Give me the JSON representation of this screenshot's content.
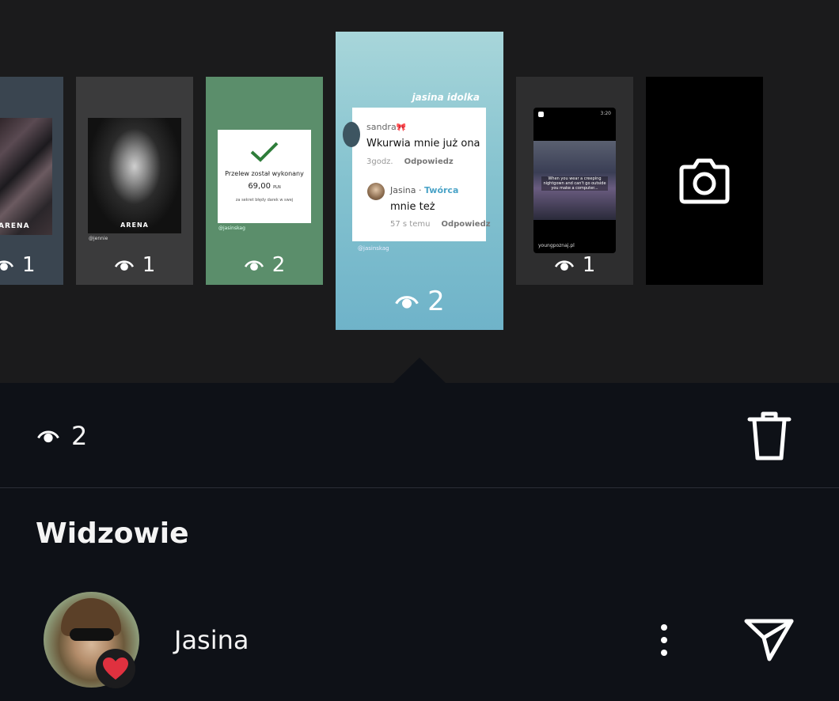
{
  "stories": [
    {
      "id": "t1",
      "image_label": "ARENA",
      "views": "1"
    },
    {
      "id": "t2",
      "image_label": "ARENA",
      "handle": "@jennie",
      "views": "1"
    },
    {
      "id": "t3",
      "transfer_title": "Przelew został wykonany",
      "amount": "69,00",
      "currency": "PLN",
      "note": "za sekret błędy darek w swej",
      "handle": "@jasinskag",
      "views": "2"
    },
    {
      "id": "t4",
      "selected": true,
      "tag": "jasina idolka",
      "handle": "@jasinskag",
      "views": "2",
      "comment": {
        "user": "sandra",
        "bow": "🎀",
        "text": "Wkurwia mnie już ona",
        "time": "3godz.",
        "reply_label": "Odpowiedz"
      },
      "reply": {
        "user": "Jasina",
        "separator": " · ",
        "role": "Twórca",
        "text": "mnie też",
        "time": "57 s temu",
        "reply_label": "Odpowiedz"
      }
    },
    {
      "id": "t5",
      "time": "3:20",
      "caption": "When you wear a creeping nightgown and can't go outside you make a computer...",
      "site": "youngpoznaj.pl",
      "views": "1"
    },
    {
      "id": "t6",
      "icon": "camera-icon"
    }
  ],
  "summary": {
    "views": "2",
    "delete_icon": "trash-icon"
  },
  "section_title": "Widzowie",
  "viewers": [
    {
      "name": "Jasina",
      "reaction": "heart",
      "actions": [
        "more-options-icon",
        "send-icon"
      ]
    }
  ],
  "colors": {
    "background": "#0e1117",
    "top_area": "#1b1b1c",
    "heart": "#e0313f",
    "creator": "#4aa3c7"
  }
}
